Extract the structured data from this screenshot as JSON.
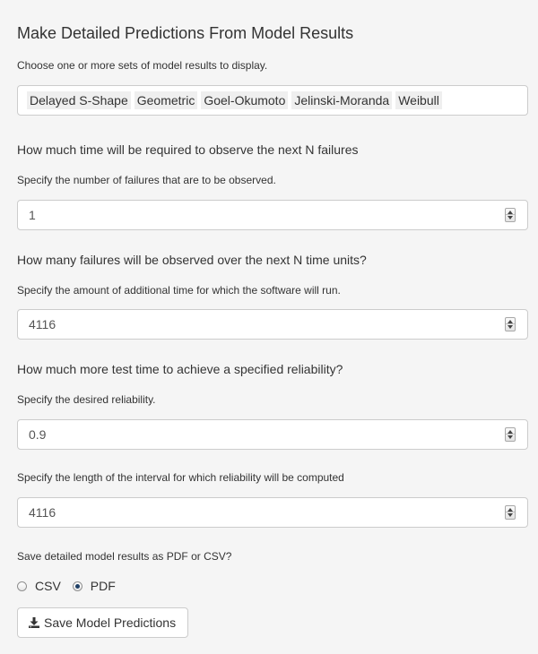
{
  "title": "Make Detailed Predictions From Model Results",
  "model_select": {
    "label": "Choose one or more sets of model results to display.",
    "selected": [
      "Delayed S-Shape",
      "Geometric",
      "Goel-Okumoto",
      "Jelinski-Moranda",
      "Weibull"
    ]
  },
  "time_to_failures": {
    "heading": "How much time will be required to observe the next N failures",
    "label": "Specify the number of failures that are to be observed.",
    "value": "1"
  },
  "failures_over_time": {
    "heading": "How many failures will be observed over the next N time units?",
    "label": "Specify the amount of additional time for which the software will run.",
    "value": "4116"
  },
  "reliability": {
    "heading": "How much more test time to achieve a specified reliability?",
    "label": "Specify the desired reliability.",
    "value": "0.9"
  },
  "interval": {
    "label": "Specify the length of the interval for which reliability will be computed",
    "value": "4116"
  },
  "save": {
    "label": "Save detailed model results as PDF or CSV?",
    "options": [
      "CSV",
      "PDF"
    ],
    "selected": "PDF",
    "button_label": "Save Model Predictions",
    "button_icon": "download-icon"
  }
}
